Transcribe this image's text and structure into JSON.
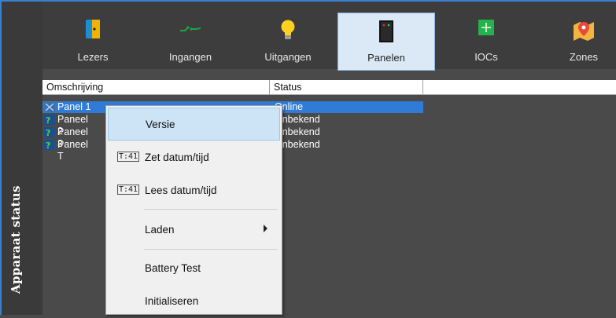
{
  "sidebar": {
    "title": "Apparaat status"
  },
  "toolbar": {
    "items": [
      {
        "label": "Lezers",
        "icon": "reader-icon"
      },
      {
        "label": "Ingangen",
        "icon": "inputs-icon"
      },
      {
        "label": "Uitgangen",
        "icon": "lightbulb-icon"
      },
      {
        "label": "Panelen",
        "icon": "panel-icon",
        "active": true
      },
      {
        "label": "IOCs",
        "icon": "ioc-board-icon"
      },
      {
        "label": "Zones",
        "icon": "map-pin-icon"
      }
    ]
  },
  "table": {
    "columns": [
      "Omschrijving",
      "Status"
    ],
    "rows": [
      {
        "name": "Panel 1",
        "status": "Online",
        "selected": true
      },
      {
        "name": "Paneel 2",
        "status": "Onbekend"
      },
      {
        "name": "Paneel 3",
        "status": "Onbekend"
      },
      {
        "name": "Paneel T",
        "status": "Onbekend"
      }
    ]
  },
  "context_menu": {
    "items": [
      {
        "label": "Versie",
        "hover": true
      },
      {
        "label": "Zet datum/tijd",
        "icon": "clock-icon",
        "icon_text": "T:41"
      },
      {
        "label": "Lees datum/tijd",
        "icon": "clock-icon",
        "icon_text": "T:41"
      },
      {
        "label": "Laden",
        "submenu": true
      },
      {
        "label": "Battery Test"
      },
      {
        "label": "Initialiseren"
      }
    ]
  },
  "colors": {
    "accent": "#2f7bd6",
    "background": "#4a4a4a",
    "toolbar": "#3d3d3d"
  }
}
